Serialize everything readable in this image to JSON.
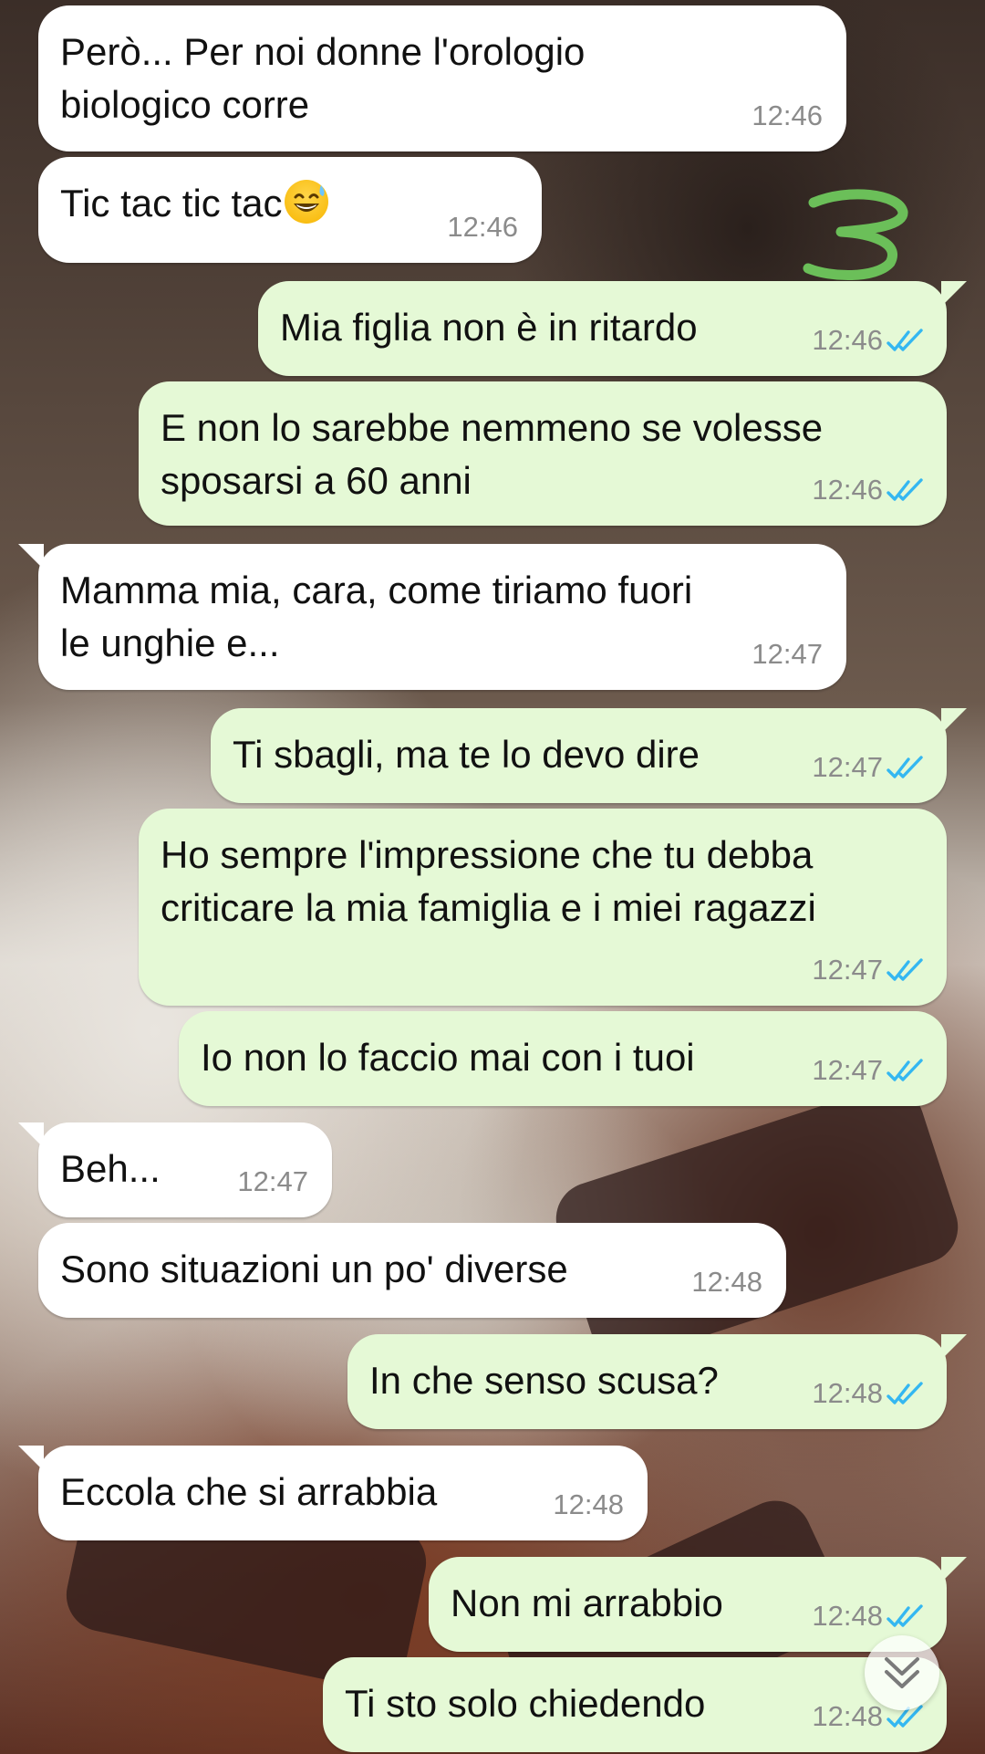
{
  "messages": [
    {
      "dir": "in",
      "text": "Però... Per noi donne l'orologio\nbiologico corre",
      "time": "12:46"
    },
    {
      "dir": "in",
      "text": "Tic tac tic tac",
      "emoji": "grinning-sweat-emoji",
      "time": "12:46"
    },
    {
      "dir": "out",
      "text": "Mia figlia non è in ritardo",
      "time": "12:46"
    },
    {
      "dir": "out",
      "text": "E non lo sarebbe nemmeno se volesse\nsposarsi a 60 anni",
      "time": "12:46"
    },
    {
      "dir": "in",
      "text": "Mamma mia, cara, come tiriamo fuori\nle unghie e...",
      "time": "12:47"
    },
    {
      "dir": "out",
      "text": "Ti sbagli, ma te lo devo dire",
      "time": "12:47"
    },
    {
      "dir": "out",
      "text": "Ho sempre l'impressione che tu debba\ncriticare la mia famiglia e i miei ragazzi",
      "time": "12:47"
    },
    {
      "dir": "out",
      "text": "Io non lo faccio mai con i tuoi",
      "time": "12:47"
    },
    {
      "dir": "in",
      "text": "Beh...",
      "time": "12:47"
    },
    {
      "dir": "in",
      "text": "Sono situazioni un po' diverse",
      "time": "12:48"
    },
    {
      "dir": "out",
      "text": "In che senso scusa?",
      "time": "12:48"
    },
    {
      "dir": "in",
      "text": "Eccola che si arrabbia",
      "time": "12:48"
    },
    {
      "dir": "out",
      "text": "Non mi arrabbio",
      "time": "12:48"
    },
    {
      "dir": "out",
      "text": "Ti sto solo chiedendo",
      "time": "12:48"
    }
  ],
  "read_receipt": {
    "icon": "double-check-icon",
    "color": "#34b7f1"
  },
  "scroll_button": {
    "icon": "chevron-double-down-icon"
  },
  "annotation": {
    "text": "3",
    "color": "#6bbf59"
  },
  "colors": {
    "incoming": "#ffffff",
    "outgoing": "#e5f9d6",
    "time": "#8b8b8b"
  }
}
